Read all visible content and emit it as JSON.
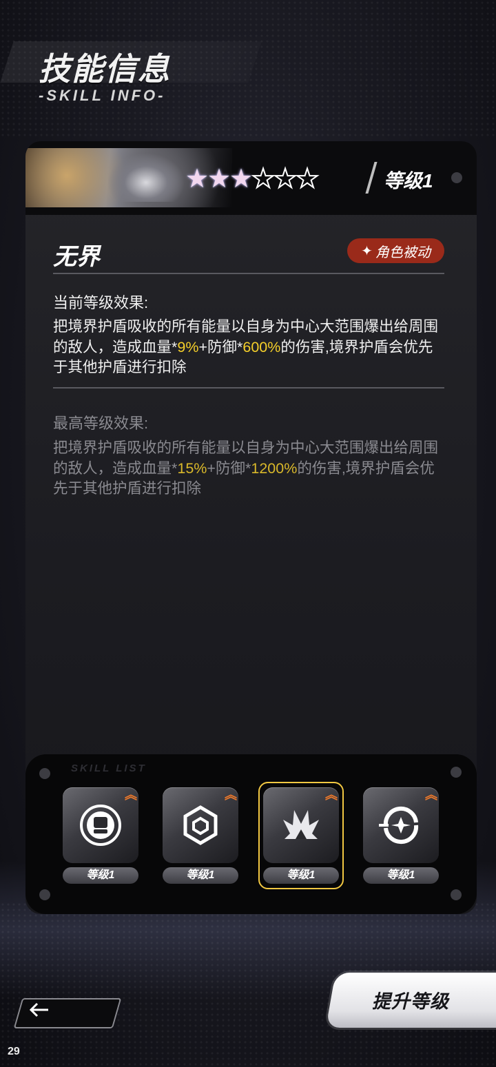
{
  "header": {
    "title": "技能信息",
    "subtitle": "-SKILL INFO-"
  },
  "skill_card": {
    "stars_filled": 3,
    "stars_total": 6,
    "level_label": "等级1",
    "skill_name": "无界",
    "badge_label": "角色被动",
    "current": {
      "label": "当前等级效果:",
      "text_1": "把境界护盾吸收的所有能量以自身为中心大范围爆出给周围的敌人，造成血量*",
      "value_1": "9%",
      "text_2": "+防御*",
      "value_2": "600%",
      "text_3": "的伤害,境界护盾会优先于其他护盾进行扣除"
    },
    "max": {
      "label": "最高等级效果:",
      "text_1": "把境界护盾吸收的所有能量以自身为中心大范围爆出给周围的敌人，造成血量*",
      "value_1": "15%",
      "text_2": "+防御*",
      "value_2": "1200%",
      "text_3": "的伤害,境界护盾会优先于其他护盾进行扣除"
    }
  },
  "skill_panel": {
    "tag": "SKILL LIST",
    "slots": [
      {
        "level": "等级1",
        "icon": "fist-shield-icon",
        "selected": false
      },
      {
        "level": "等级1",
        "icon": "hexagon-cube-icon",
        "selected": false
      },
      {
        "level": "等级1",
        "icon": "burst-crown-icon",
        "selected": true
      },
      {
        "level": "等级1",
        "icon": "orbit-star-icon",
        "selected": false
      }
    ]
  },
  "footer": {
    "back_icon": "left-arrow-icon",
    "upgrade_label": "提升等级",
    "page_number": "29"
  },
  "colors": {
    "highlight": "#f5cf2a",
    "badge": "#9a2a1a",
    "selected_frame": "#f2c842",
    "upgrade_arrow": "#f07a2a"
  }
}
